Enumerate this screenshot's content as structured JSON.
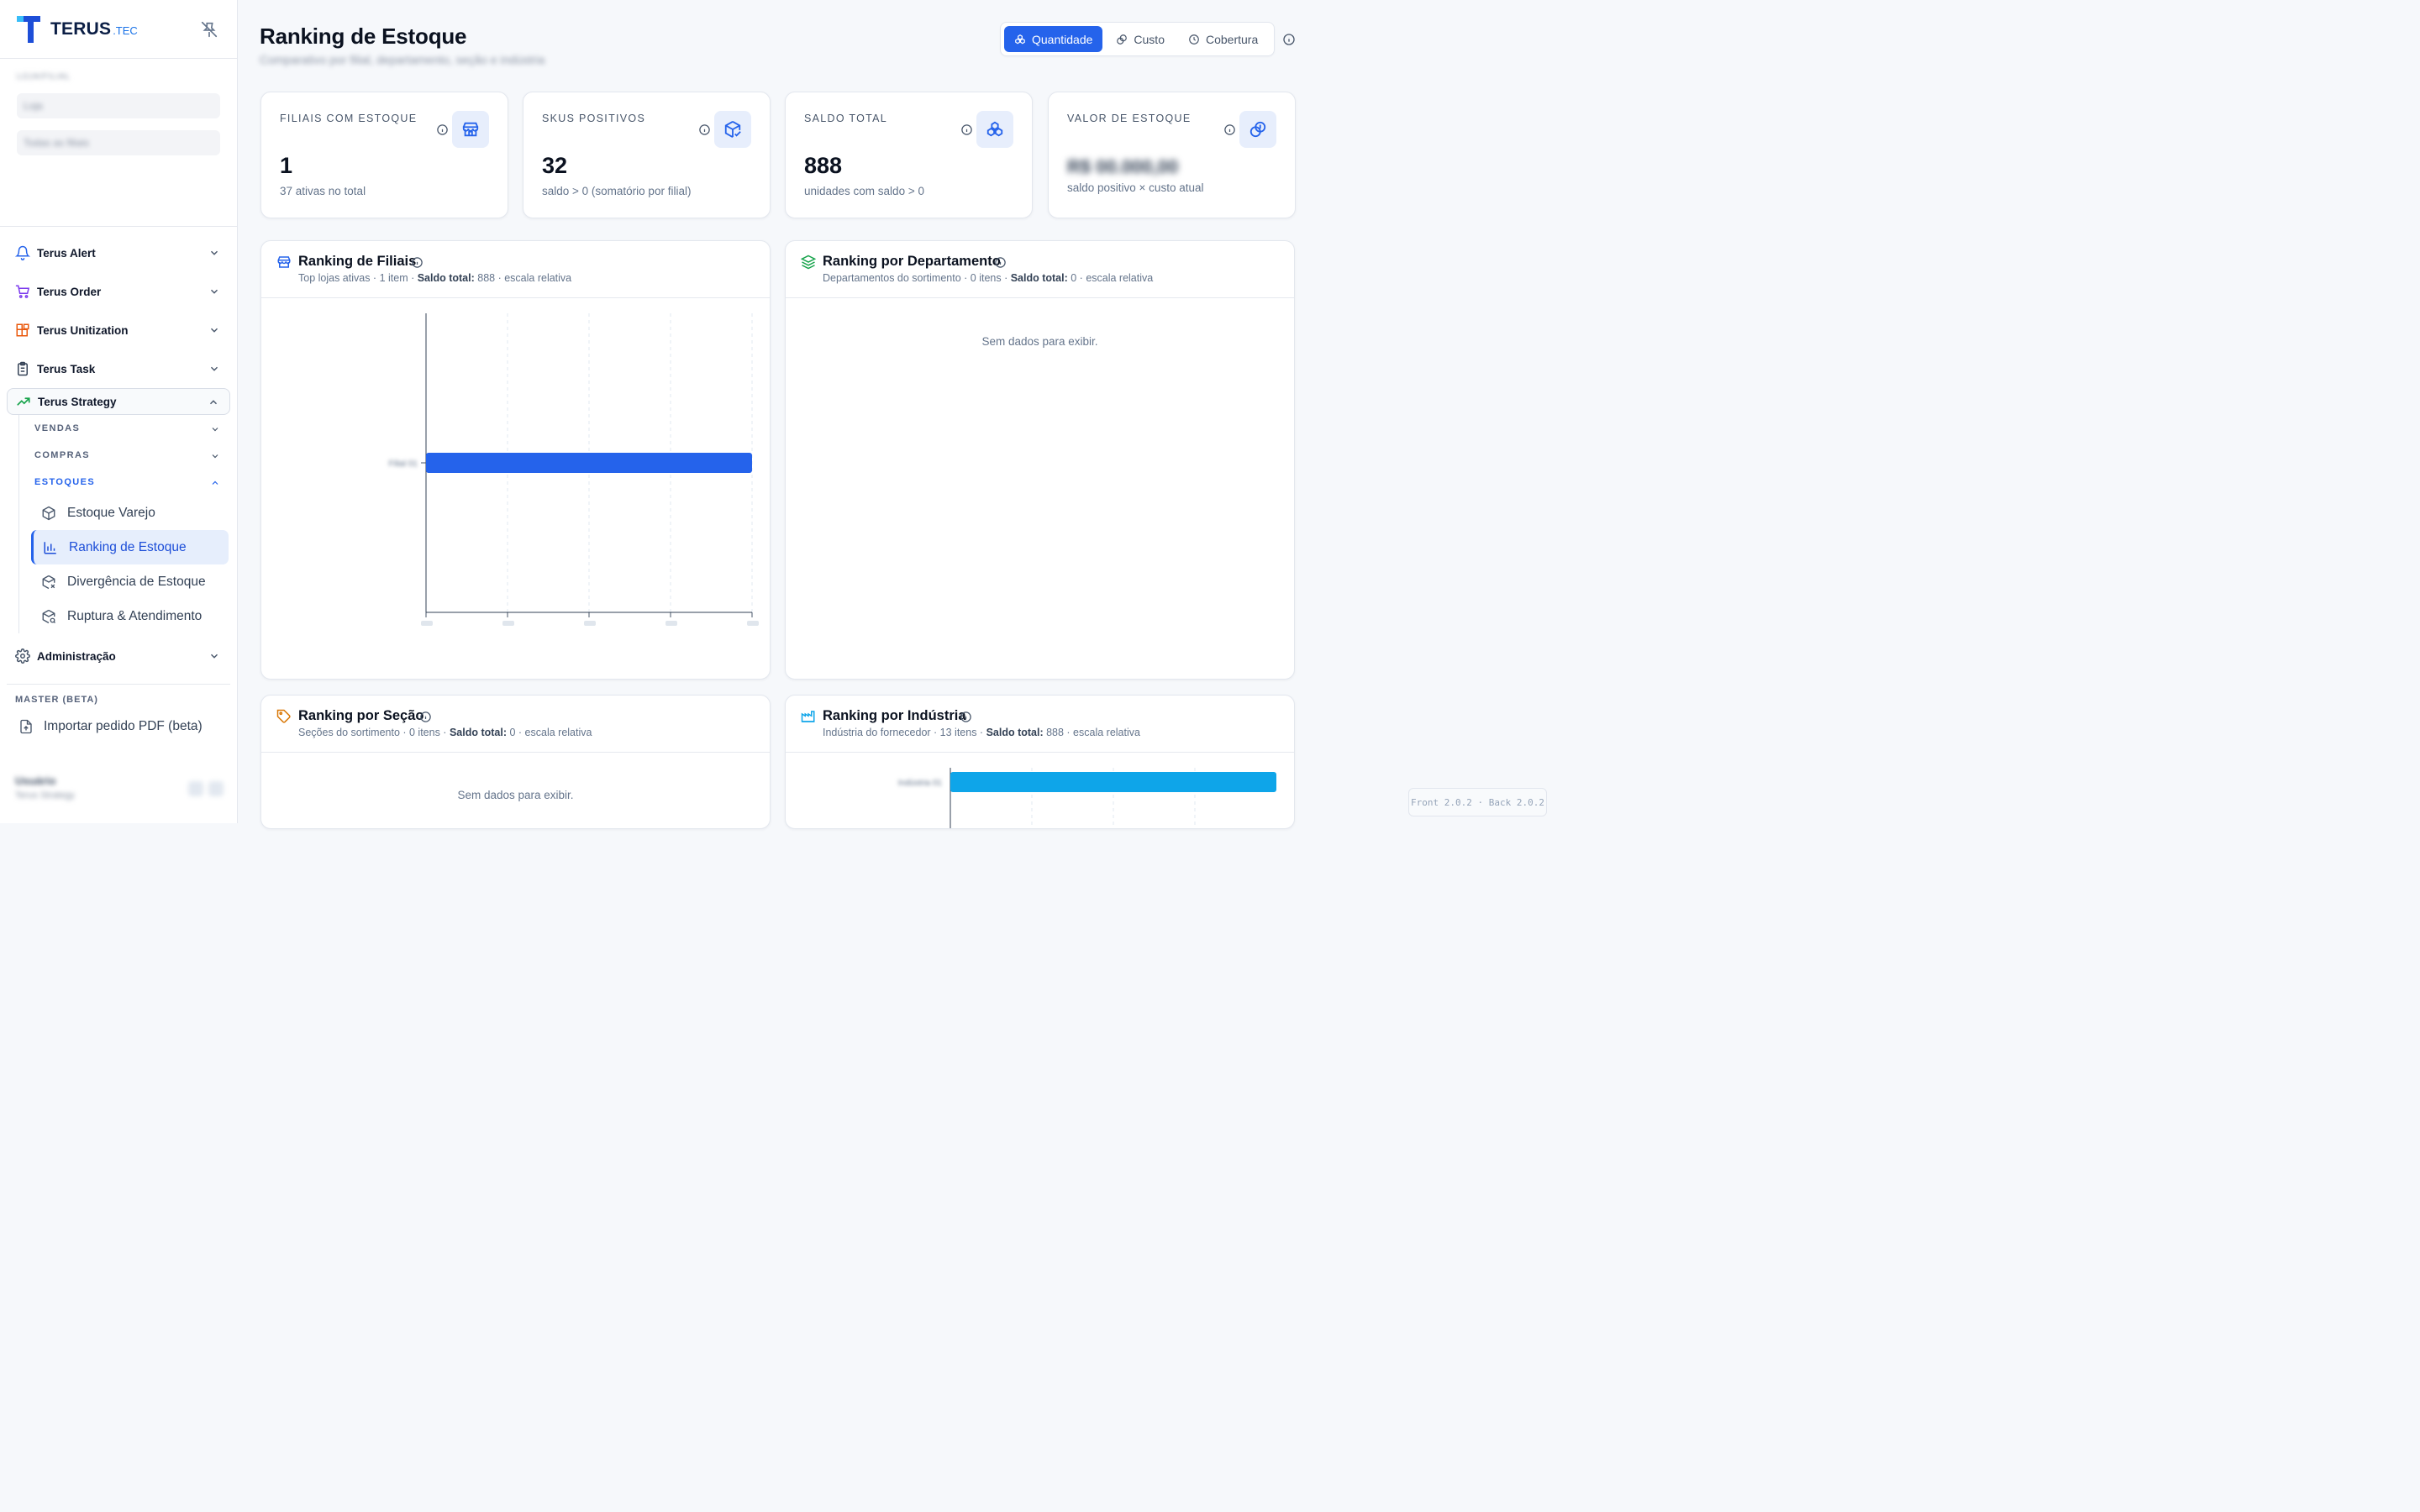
{
  "app": {
    "brand_name": "TERUS",
    "brand_suffix": ".TEC",
    "brand_color": "#0b1e45",
    "accent": "#2563eb"
  },
  "sidebar": {
    "filters": {
      "label": "LOJA/FILIAL",
      "field_1": "Loja",
      "field_2": "Todas as filiais"
    },
    "nav": [
      {
        "label": "Terus Alert",
        "icon": "bell-icon"
      },
      {
        "label": "Terus Order",
        "icon": "cart-icon"
      },
      {
        "label": "Terus Unitization",
        "icon": "blocks-icon"
      },
      {
        "label": "Terus Task",
        "icon": "clipboard-icon"
      },
      {
        "label": "Terus Strategy",
        "icon": "trending-up-icon"
      }
    ],
    "strategy_sub": {
      "vendas": "VENDAS",
      "compras": "COMPRAS",
      "estoques": "ESTOQUES",
      "leaves": [
        {
          "label": "Estoque Varejo",
          "icon": "package-icon"
        },
        {
          "label": "Ranking de Estoque",
          "icon": "bar-chart-icon"
        },
        {
          "label": "Divergência de Estoque",
          "icon": "package-x-icon"
        },
        {
          "label": "Ruptura & Atendimento",
          "icon": "package-search-icon"
        }
      ]
    },
    "admin": "Administração",
    "section_label": "MASTER (BETA)",
    "import_label": "Importar pedido PDF (beta)",
    "user_name": "Usuário",
    "user_role": "Terus Strategy"
  },
  "header": {
    "title": "Ranking de Estoque",
    "subtitle": "Comparativo por filial, departamento, seção e indústria",
    "tabs": [
      "Quantidade",
      "Custo",
      "Cobertura"
    ],
    "active_tab": "Quantidade"
  },
  "kpis": [
    {
      "label": "FILIAIS COM ESTOQUE",
      "value": "1",
      "note": "37 ativas no total",
      "icon": "store-icon"
    },
    {
      "label": "SKUS POSITIVOS",
      "value": "32",
      "note": "saldo > 0 (somatório por filial)",
      "icon": "package-check-icon"
    },
    {
      "label": "SALDO TOTAL",
      "value": "888",
      "note": "unidades com saldo > 0",
      "icon": "boxes-icon"
    },
    {
      "label": "VALOR DE ESTOQUE",
      "value": "R$ 00.000,00",
      "note": "saldo positivo × custo atual",
      "icon": "coins-icon"
    }
  ],
  "panels": {
    "filiais": {
      "title": "Ranking de Filiais",
      "sub_prefix": "Top lojas ativas · 1 item · ",
      "sub_bold": "Saldo total:",
      "sub_suffix": " 888 · escala relativa"
    },
    "departamento": {
      "title": "Ranking por Departamento",
      "sub_prefix": "Departamentos do sortimento · 0 itens · ",
      "sub_bold": "Saldo total:",
      "sub_suffix": " 0 · escala relativa",
      "empty": "Sem dados para exibir."
    },
    "secao": {
      "title": "Ranking por Seção",
      "sub_prefix": "Seções do sortimento · 0 itens · ",
      "sub_bold": "Saldo total:",
      "sub_suffix": " 0 · escala relativa",
      "empty": "Sem dados para exibir."
    },
    "industria": {
      "title": "Ranking por Indústria",
      "sub_prefix": "Indústria do fornecedor · 13 itens · ",
      "sub_bold": "Saldo total:",
      "sub_suffix": " 888 · escala relativa"
    }
  },
  "chart_data": [
    {
      "type": "bar",
      "orientation": "horizontal",
      "categories": [
        "Filial 01"
      ],
      "values": [
        888
      ],
      "xlim": [
        0,
        888
      ],
      "grid": true,
      "color": "#2563eb"
    },
    {
      "type": "bar",
      "orientation": "horizontal",
      "categories": [
        "Indústria 01"
      ],
      "values": [
        888
      ],
      "color": "#0ea5e9"
    }
  ],
  "version": "Front 2.0.2 · Back 2.0.2"
}
